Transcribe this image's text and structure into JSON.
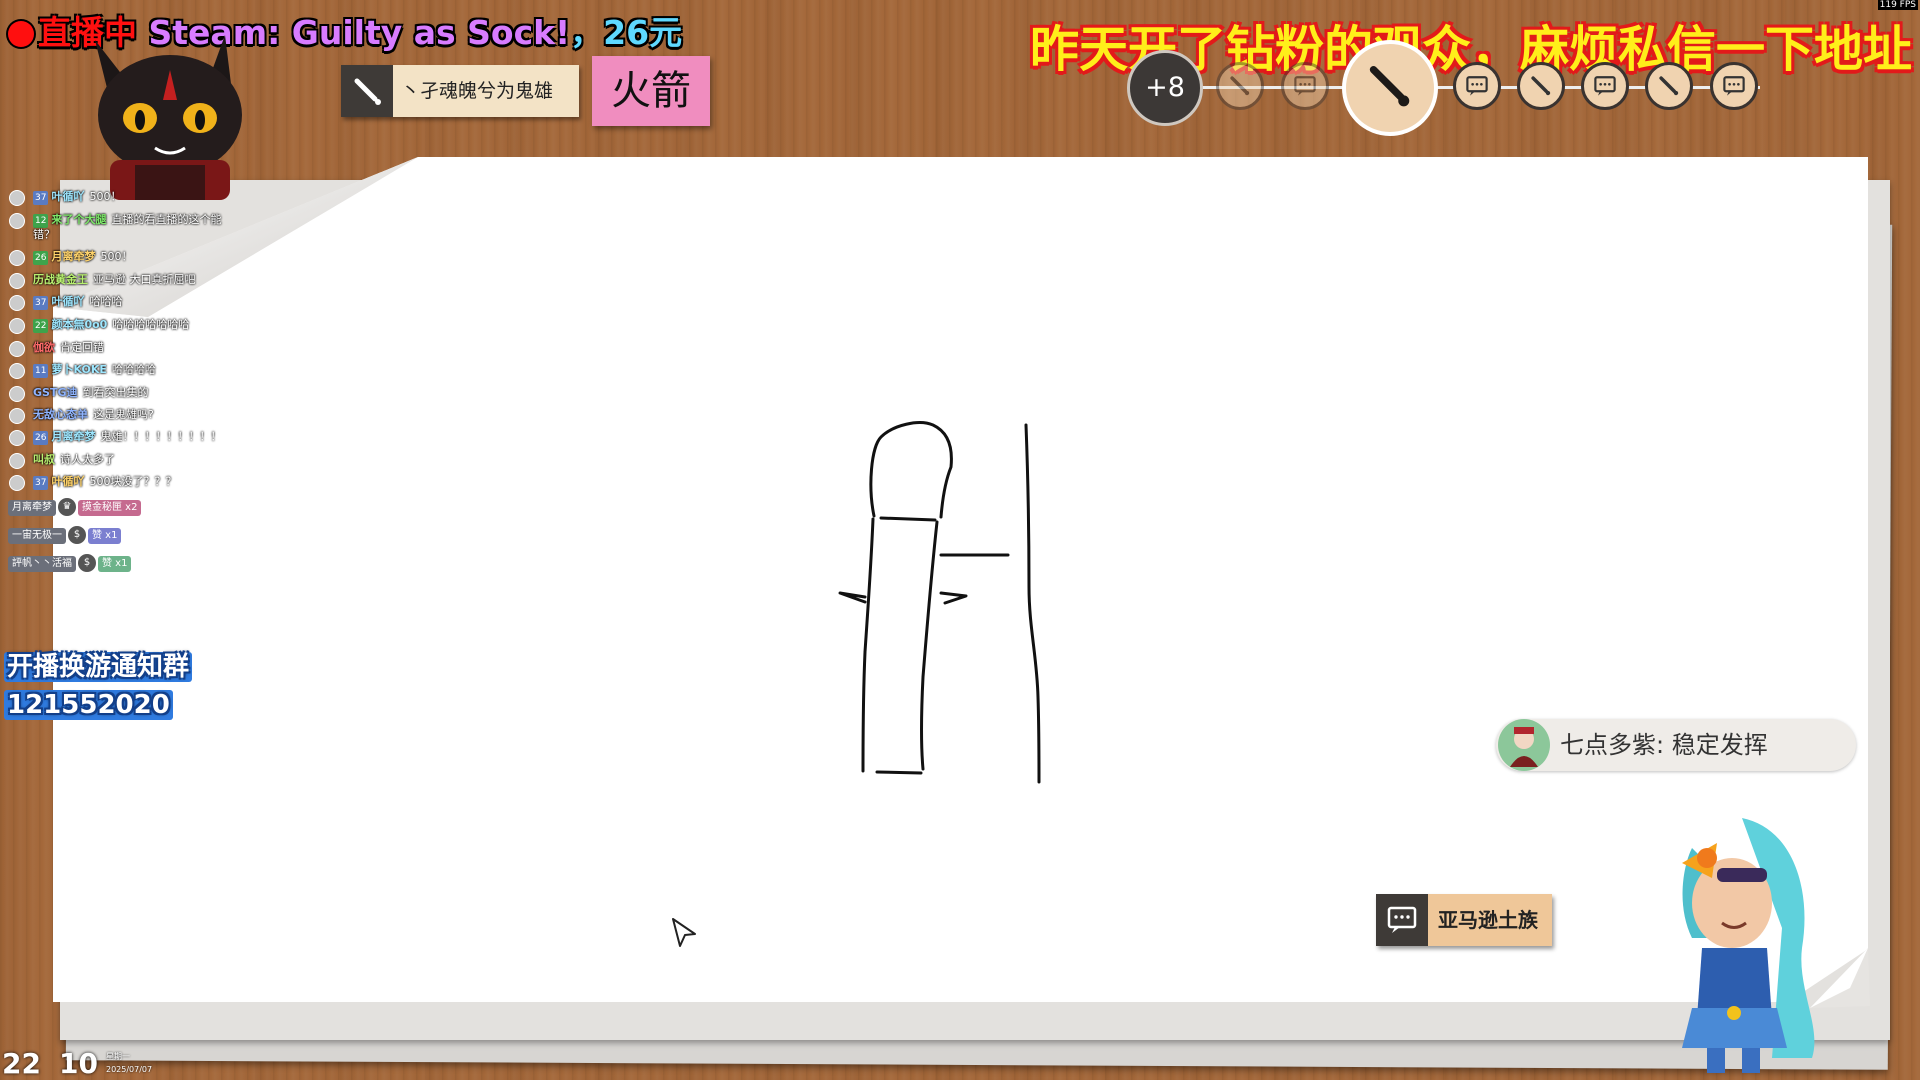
{
  "stream": {
    "live_label": "直播中",
    "game_label": "Steam: Guilty as Sock!",
    "price_label": "，26元",
    "fps": "119 FPS"
  },
  "announcement": "昨天开了钻粉的观众，麻烦私信一下地址",
  "game": {
    "clue": "丶孑魂魄兮为鬼雄",
    "word": "火箭",
    "players_count": "+8",
    "guess": {
      "user": "七点多紫",
      "text": "稳定发挥"
    },
    "theme": "亚马逊土族"
  },
  "chat": {
    "messages": [
      {
        "level": "37",
        "user": "叶循吖",
        "text": "500！"
      },
      {
        "level": "12",
        "user": "来了个大腿",
        "text": "直播的看直播的这个能错？"
      },
      {
        "level": "26",
        "user": "月离牵梦",
        "text": "500！"
      },
      {
        "level": "",
        "user": "历战黄金王",
        "text": "亚马逊 大口真折屈吧"
      },
      {
        "level": "37",
        "user": "叶循吖",
        "text": "哈哈哈"
      },
      {
        "level": "22",
        "user": "颜本無0o0",
        "text": "哈哈哈哈哈哈哈"
      },
      {
        "level": "",
        "user": "伽欲",
        "text": "肯定回错"
      },
      {
        "level": "11",
        "user": "萝卜KOKE",
        "text": "哈哈哈哈"
      },
      {
        "level": "",
        "user": "GSTG迪",
        "text": "到看突出集的"
      },
      {
        "level": "",
        "user": "无敌心态单",
        "text": "这是鬼雄吗?"
      },
      {
        "level": "26",
        "user": "月离牵梦",
        "text": "鬼雄！！！！！！！！！"
      },
      {
        "level": "",
        "user": "叫叔",
        "text": "诗人太多了"
      },
      {
        "level": "37",
        "user": "叶循吖",
        "text": "500块没了？？？"
      }
    ],
    "gifts": [
      {
        "user": "月离牵梦",
        "gift": "摸金秘匣 x2",
        "color": "#c56a8f"
      },
      {
        "user": "一宙无极一",
        "gift": "赞 x1",
        "color": "#7b7fd0"
      },
      {
        "user": "評帆丶丶活福",
        "gift": "赞 x1",
        "color": "#6db38a"
      }
    ]
  },
  "group_notice": {
    "line1": "开播换游通知群",
    "line2": "121552020"
  },
  "clock": {
    "hour": "22",
    "minute": "10",
    "weekday": "星期一",
    "date": "2025/07/07"
  }
}
